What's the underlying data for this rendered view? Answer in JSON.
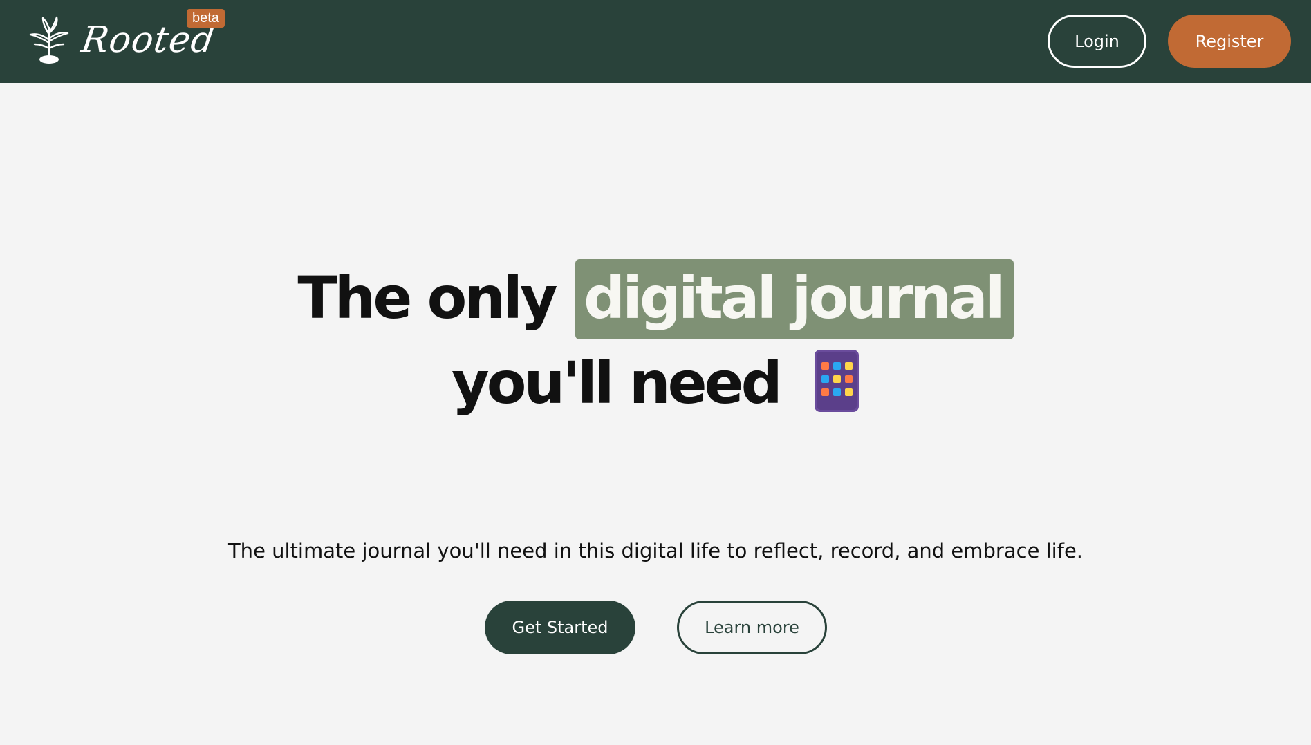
{
  "navbar": {
    "logo_text": "Rooted",
    "logo_icon": "plant-sprout-icon",
    "beta_label": "beta",
    "login_label": "Login",
    "register_label": "Register"
  },
  "hero": {
    "headline_prefix": "The only",
    "headline_highlight": "digital journal",
    "headline_line2": "you'll need",
    "headline_icon": "tablet-icon",
    "subtitle": "The ultimate journal you'll need in this digital life to reflect, record, and embrace life.",
    "primary_button": "Get Started",
    "secondary_button": "Learn more"
  },
  "colors": {
    "navbar_bg": "#29423a",
    "accent_orange": "#c16a34",
    "highlight_green": "#7f9175",
    "page_bg": "#f4f4f4"
  }
}
